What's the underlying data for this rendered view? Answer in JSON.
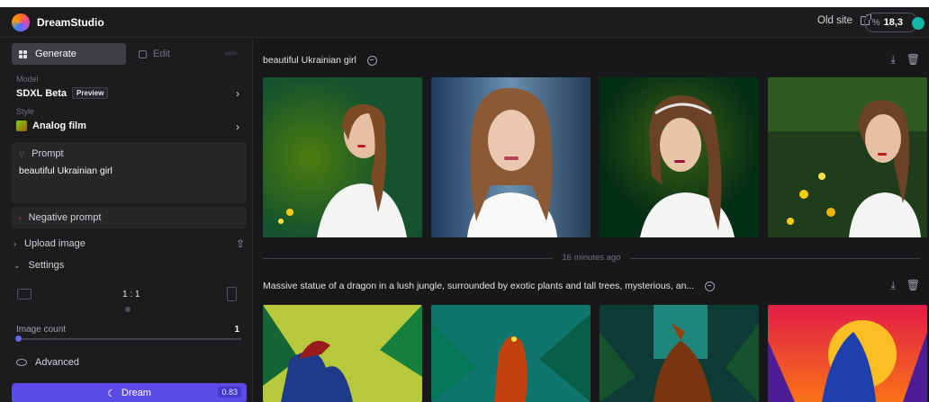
{
  "app": {
    "name": "DreamStudio"
  },
  "topbar": {
    "old_site_label": "Old site",
    "credits": "18,3",
    "credits_icon": "credit-icon"
  },
  "sidebar": {
    "tabs": [
      {
        "label": "Generate",
        "icon": "grid-icon",
        "active": true
      },
      {
        "label": "Edit",
        "icon": "edit-icon",
        "active": false,
        "badge": "soon"
      }
    ],
    "model": {
      "label": "Model",
      "value": "SDXL Beta",
      "badge": "Preview"
    },
    "style": {
      "label": "Style",
      "value": "Analog film"
    },
    "prompt": {
      "label": "Prompt",
      "text": "beautiful Ukrainian girl"
    },
    "negative_prompt": {
      "label": "Negative prompt"
    },
    "upload": {
      "label": "Upload image"
    },
    "settings": {
      "label": "Settings",
      "aspect_ratio": "1 : 1",
      "image_count_label": "Image count",
      "image_count": "1"
    },
    "advanced": {
      "label": "Advanced"
    },
    "dream": {
      "label": "Dream",
      "cost": "0.83"
    }
  },
  "main": {
    "groups": [
      {
        "title": "beautiful Ukrainian girl",
        "images": [
          "portrait-1",
          "portrait-2",
          "portrait-3",
          "portrait-4"
        ]
      },
      {
        "title": "Massive statue of a dragon in a lush jungle, surrounded by exotic plants and tall trees, mysterious, an...",
        "images": [
          "dragon-1",
          "dragon-2",
          "dragon-3",
          "dragon-4"
        ]
      }
    ],
    "separator": "16 minutes ago"
  },
  "colors": {
    "accent": "#5b4ae6",
    "background": "#18181b",
    "sidebar": "#1c1c1f",
    "panel": "#27272a"
  }
}
